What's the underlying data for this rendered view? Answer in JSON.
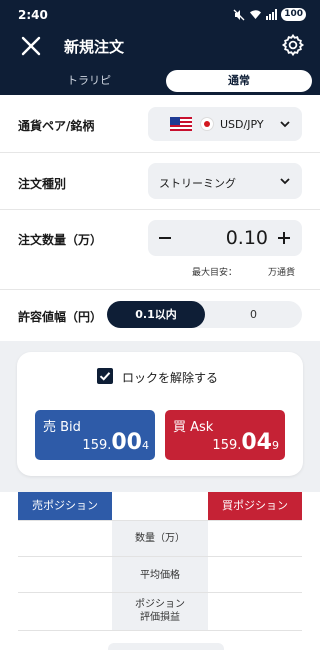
{
  "status": {
    "time": "2:40",
    "battery": "100"
  },
  "header": {
    "title": "新規注文"
  },
  "tabs": [
    {
      "label": "トラリピ"
    },
    {
      "label": "通常"
    }
  ],
  "form": {
    "pair": {
      "label": "通貨ペア/銘柄",
      "value": "USD/JPY"
    },
    "order_type": {
      "label": "注文種別",
      "value": "ストリーミング"
    },
    "quantity": {
      "label": "注文数量（万）",
      "value": "0.10",
      "minus": "−",
      "plus": "+",
      "max_label": "最大目安：",
      "unit": "万通貨"
    },
    "slippage": {
      "label": "許容値幅（円）",
      "options": [
        "0.1以内",
        "0"
      ],
      "selected_index": 0
    }
  },
  "order": {
    "unlock_label": "ロックを解除する",
    "unlock_checked": true,
    "bid": {
      "label": "売 Bid",
      "price_main": "159.",
      "price_big": "00",
      "price_tiny": "4"
    },
    "ask": {
      "label": "買 Ask",
      "price_main": "159.",
      "price_big": "04",
      "price_tiny": "9"
    }
  },
  "positions": {
    "sell_label": "売ポジション",
    "buy_label": "買ポジション",
    "rows": [
      {
        "label": "数量（万）"
      },
      {
        "label": "平均価格"
      },
      {
        "label_line1": "ポジション",
        "label_line2": "評価損益"
      }
    ]
  },
  "colors": {
    "navy": "#0e1e36",
    "bid_blue": "#2e5ba8",
    "ask_red": "#c52235"
  }
}
